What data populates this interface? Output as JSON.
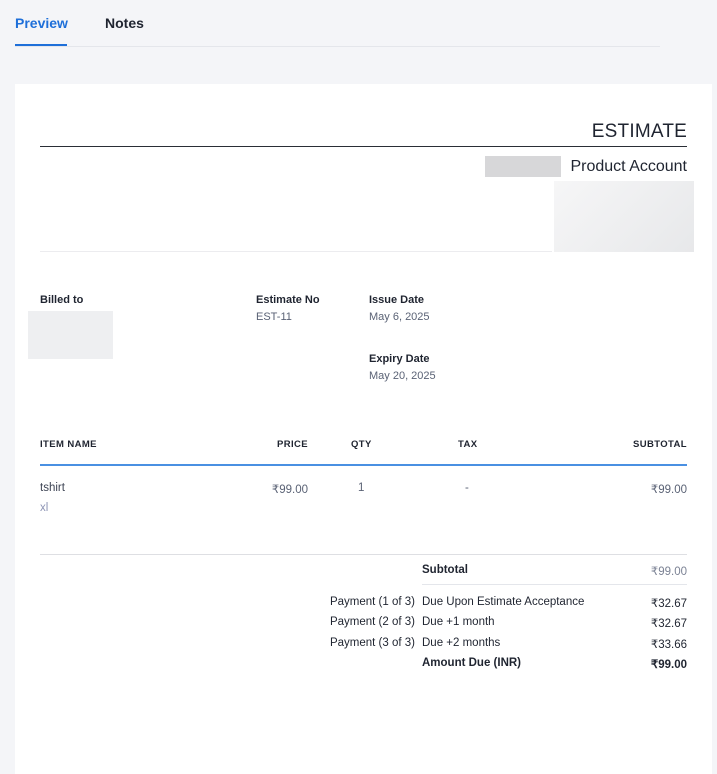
{
  "tabs": [
    {
      "label": "Preview",
      "active": true
    },
    {
      "label": "Notes",
      "active": false
    }
  ],
  "document": {
    "title": "ESTIMATE",
    "company_name": "Product Account",
    "billed_to_label": "Billed to",
    "estimate_no_label": "Estimate No",
    "estimate_no": "EST-11",
    "issue_date_label": "Issue Date",
    "issue_date": "May 6, 2025",
    "expiry_date_label": "Expiry Date",
    "expiry_date": "May 20, 2025"
  },
  "table": {
    "headers": {
      "item": "ITEM NAME",
      "price": "PRICE",
      "qty": "QTY",
      "tax": "TAX",
      "subtotal": "SUBTOTAL"
    },
    "rows": [
      {
        "name": "tshirt",
        "description": "xl",
        "price": "₹99.00",
        "qty": "1",
        "tax": "-",
        "subtotal": "₹99.00"
      }
    ]
  },
  "summary": {
    "subtotal_label": "Subtotal",
    "subtotal_value": "₹99.00",
    "payments": [
      {
        "label": "Payment (1 of 3)",
        "due": "Due Upon Estimate Acceptance",
        "amount": "₹32.67"
      },
      {
        "label": "Payment (2 of 3)",
        "due": "Due +1 month",
        "amount": "₹32.67"
      },
      {
        "label": "Payment (3 of 3)",
        "due": "Due +2 months",
        "amount": "₹33.66"
      }
    ],
    "amount_due_label": "Amount Due (INR)",
    "amount_due_value": "₹99.00"
  },
  "colors": {
    "accent": "#1e6fd9",
    "table_rule": "#4a90e2"
  }
}
